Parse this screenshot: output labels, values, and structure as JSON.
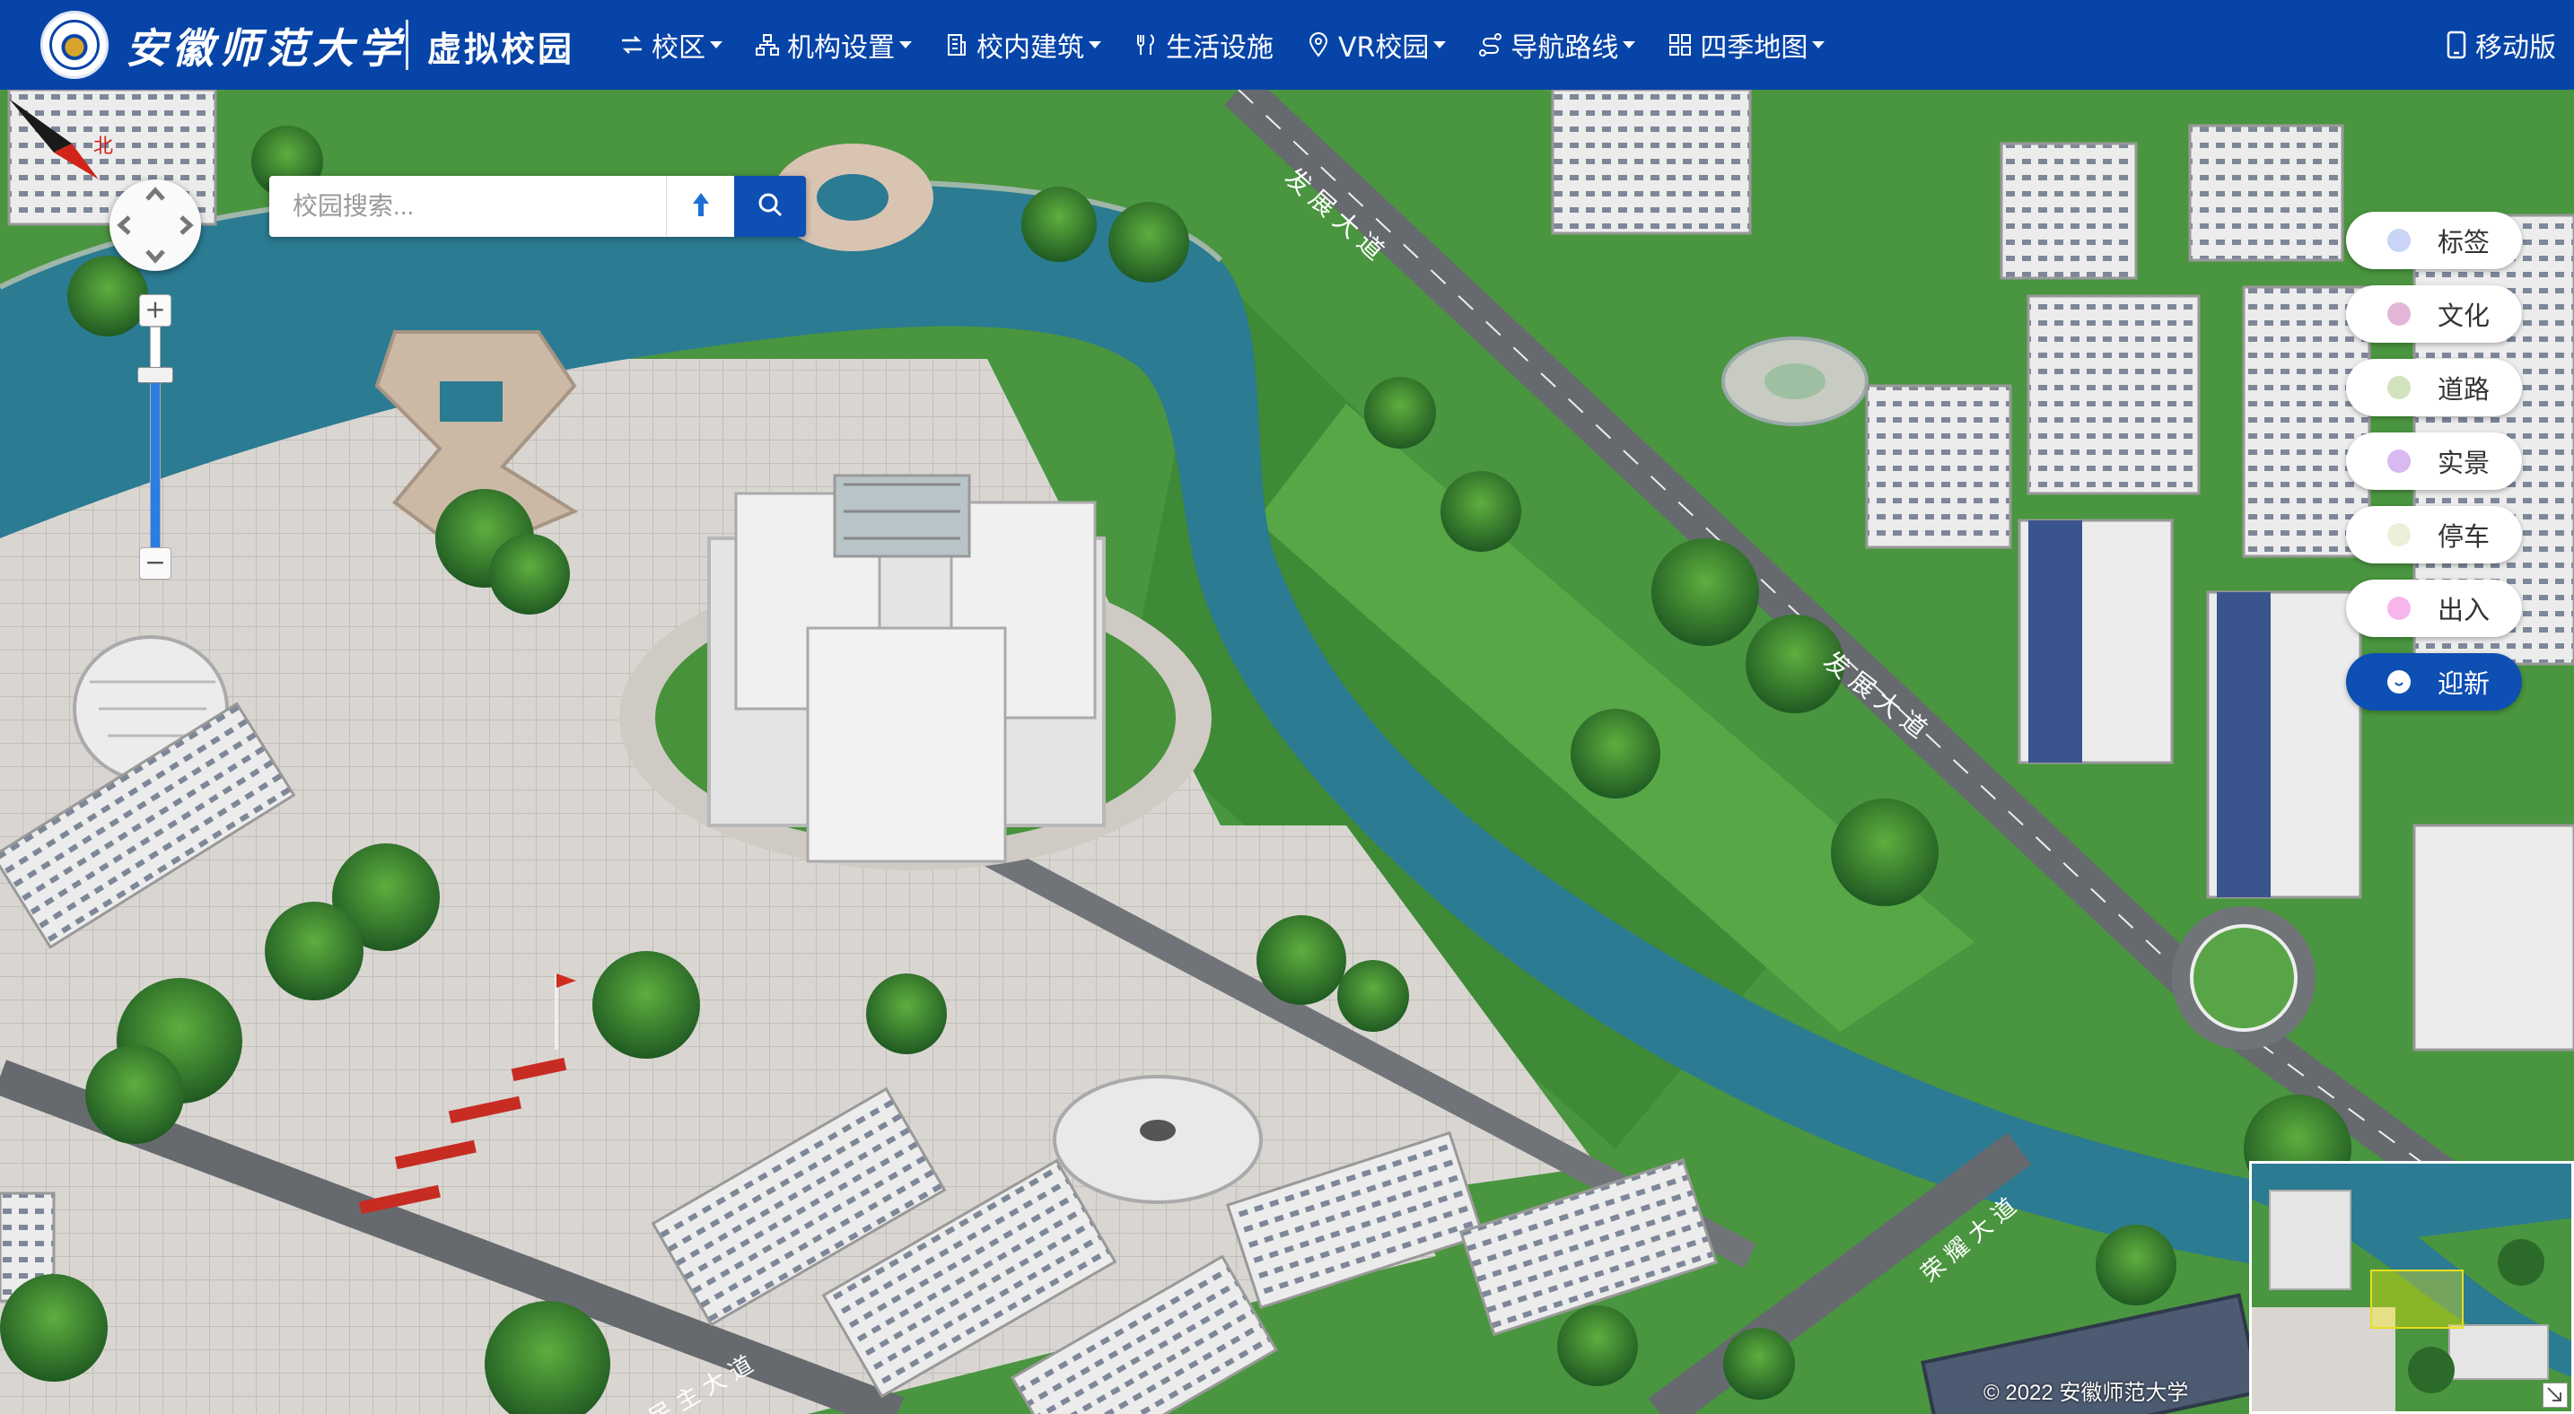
{
  "header": {
    "school_name": "安徽师范大学",
    "site_title": "虚拟校园",
    "mobile_label": "移动版"
  },
  "nav": [
    {
      "label": "校区",
      "icon": "swap-icon",
      "dropdown": true
    },
    {
      "label": "机构设置",
      "icon": "org-chart-icon",
      "dropdown": true
    },
    {
      "label": "校内建筑",
      "icon": "building-icon",
      "dropdown": true
    },
    {
      "label": "生活设施",
      "icon": "utensils-icon",
      "dropdown": false
    },
    {
      "label": "VR校园",
      "icon": "location-pin-icon",
      "dropdown": true
    },
    {
      "label": "导航路线",
      "icon": "route-icon",
      "dropdown": true
    },
    {
      "label": "四季地图",
      "icon": "grid-icon",
      "dropdown": true
    }
  ],
  "search": {
    "placeholder": "校园搜索..."
  },
  "zoom": {
    "plus": "+",
    "minus": "−",
    "level": 0.78
  },
  "layers": [
    {
      "label": "标签",
      "color": "#c9d4f7",
      "active": false
    },
    {
      "label": "文化",
      "color": "#e3b6d8",
      "active": false
    },
    {
      "label": "道路",
      "color": "#d3e3bf",
      "active": false
    },
    {
      "label": "实景",
      "color": "#d8b9f2",
      "active": false
    },
    {
      "label": "停车",
      "color": "#ecefd9",
      "active": false
    },
    {
      "label": "出入",
      "color": "#f6b6ec",
      "active": false
    },
    {
      "label": "迎新",
      "color": "#ffffff",
      "active": true
    }
  ],
  "map_labels": {
    "road_1": "发展大道",
    "road_2": "发展大道",
    "road_3": "民主大道",
    "road_4": "荣耀大道",
    "compass_north": "北"
  },
  "copyright": "© 2022 安徽师范大学",
  "colors": {
    "navbar": "#0744a8",
    "accent": "#0d4fb3",
    "water": "#2b7b92",
    "grass": "#3f8a3a"
  }
}
